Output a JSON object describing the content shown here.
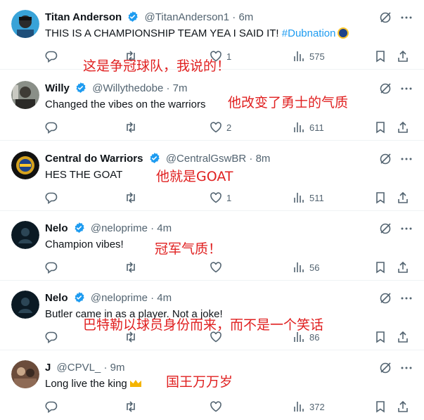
{
  "tweets": [
    {
      "name": "Titan Anderson",
      "handle": "@TitanAnderson1",
      "dot": "·",
      "time": "6m",
      "text": "THIS IS A CHAMPIONSHIP TEAM YEA I SAID IT! ",
      "hashtag": "#Dubnation",
      "replies": "",
      "retweets": "",
      "likes": "1",
      "views": "575",
      "translation": "这是争冠球队，我说的！"
    },
    {
      "name": "Willy",
      "handle": "@Willythedobe",
      "dot": "·",
      "time": "7m",
      "text": "Changed the vibes on the warriors",
      "replies": "",
      "retweets": "",
      "likes": "2",
      "views": "611",
      "translation": "他改变了勇士的气质"
    },
    {
      "name": "Central do Warriors",
      "handle": "@CentralGswBR",
      "dot": "·",
      "time": "8m",
      "text": "HES THE GOAT",
      "replies": "",
      "retweets": "",
      "likes": "1",
      "views": "511",
      "translation": "他就是GOAT"
    },
    {
      "name": "Nelo",
      "handle": "@neloprime",
      "dot": "·",
      "time": "4m",
      "text": "Champion vibes!",
      "replies": "",
      "retweets": "",
      "likes": "",
      "views": "56",
      "translation": "冠军气质！"
    },
    {
      "name": "Nelo",
      "handle": "@neloprime",
      "dot": "·",
      "time": "4m",
      "text": "Butler came in as a player. Not a joke!",
      "replies": "",
      "retweets": "",
      "likes": "",
      "views": "86",
      "translation": "巴特勒以球员身份而来，而不是一个笑话"
    },
    {
      "name": "J",
      "handle": "@CPVL_",
      "dot": "·",
      "time": "9m",
      "text": "Long live the king",
      "replies": "",
      "retweets": "",
      "likes": "",
      "views": "372",
      "translation": "国王万万岁"
    }
  ],
  "colors": {
    "accent": "#1d9bf0",
    "muted": "#536471",
    "overlay": "#e02020"
  },
  "icons": [
    "verified-badge-icon",
    "grok-icon",
    "more-icon",
    "reply-icon",
    "retweet-icon",
    "like-icon",
    "views-icon",
    "bookmark-icon",
    "share-icon",
    "crown-emoji-icon"
  ]
}
